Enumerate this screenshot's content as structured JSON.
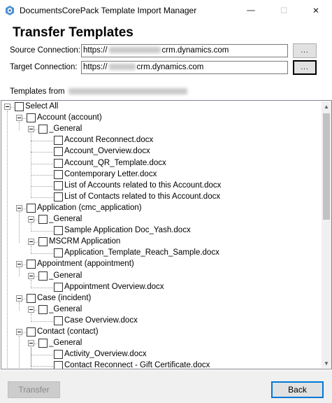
{
  "window": {
    "title": "DocumentsCorePack Template Import Manager",
    "minimize_glyph": "—",
    "maximize_glyph": "☐",
    "close_glyph": "✕"
  },
  "heading": "Transfer Templates",
  "source": {
    "label": "Source Connection:",
    "prefix": "https://",
    "suffix": "crm.dynamics.com",
    "browse_label": "...",
    "blurred": true
  },
  "target": {
    "label": "Target Connection:",
    "prefix": "https://",
    "suffix": "crm.dynamics.com",
    "browse_label": "...",
    "blurred": true
  },
  "templates_from": {
    "label": "Templates from",
    "blurred": true
  },
  "tree": {
    "rows": [
      {
        "level": 0,
        "label": "Select All",
        "expander": true
      },
      {
        "level": 1,
        "label": "Account (account)",
        "expander": true
      },
      {
        "level": 2,
        "label": "_General",
        "expander": true
      },
      {
        "level": 3,
        "label": "Account Reconnect.docx"
      },
      {
        "level": 3,
        "label": "Account_Overview.docx"
      },
      {
        "level": 3,
        "label": "Account_QR_Template.docx"
      },
      {
        "level": 3,
        "label": "Contemporary Letter.docx"
      },
      {
        "level": 3,
        "label": "List of Accounts related to this Account.docx"
      },
      {
        "level": 3,
        "label": "List of Contacts related to this Account.docx"
      },
      {
        "level": 1,
        "label": "Application (cmc_application)",
        "expander": true
      },
      {
        "level": 2,
        "label": "_General",
        "expander": true
      },
      {
        "level": 3,
        "label": "Sample Application Doc_Yash.docx"
      },
      {
        "level": 2,
        "label": "MSCRM Application",
        "expander": true
      },
      {
        "level": 3,
        "label": "Application_Template_Reach_Sample.docx"
      },
      {
        "level": 1,
        "label": "Appointment (appointment)",
        "expander": true
      },
      {
        "level": 2,
        "label": "_General",
        "expander": true
      },
      {
        "level": 3,
        "label": "Appointment Overview.docx"
      },
      {
        "level": 1,
        "label": "Case (incident)",
        "expander": true
      },
      {
        "level": 2,
        "label": "_General",
        "expander": true
      },
      {
        "level": 3,
        "label": "Case Overview.docx"
      },
      {
        "level": 1,
        "label": "Contact (contact)",
        "expander": true
      },
      {
        "level": 2,
        "label": "_General",
        "expander": true
      },
      {
        "level": 3,
        "label": "Activity_Overview.docx"
      },
      {
        "level": 3,
        "label": "Contact Reconnect - Gift Certificate.docx"
      }
    ]
  },
  "buttons": {
    "transfer": "Transfer",
    "back": "Back"
  },
  "colors": {
    "focus_border": "#0078d7",
    "button_face": "#e1e1e1",
    "footer": "#f0f0f0"
  }
}
